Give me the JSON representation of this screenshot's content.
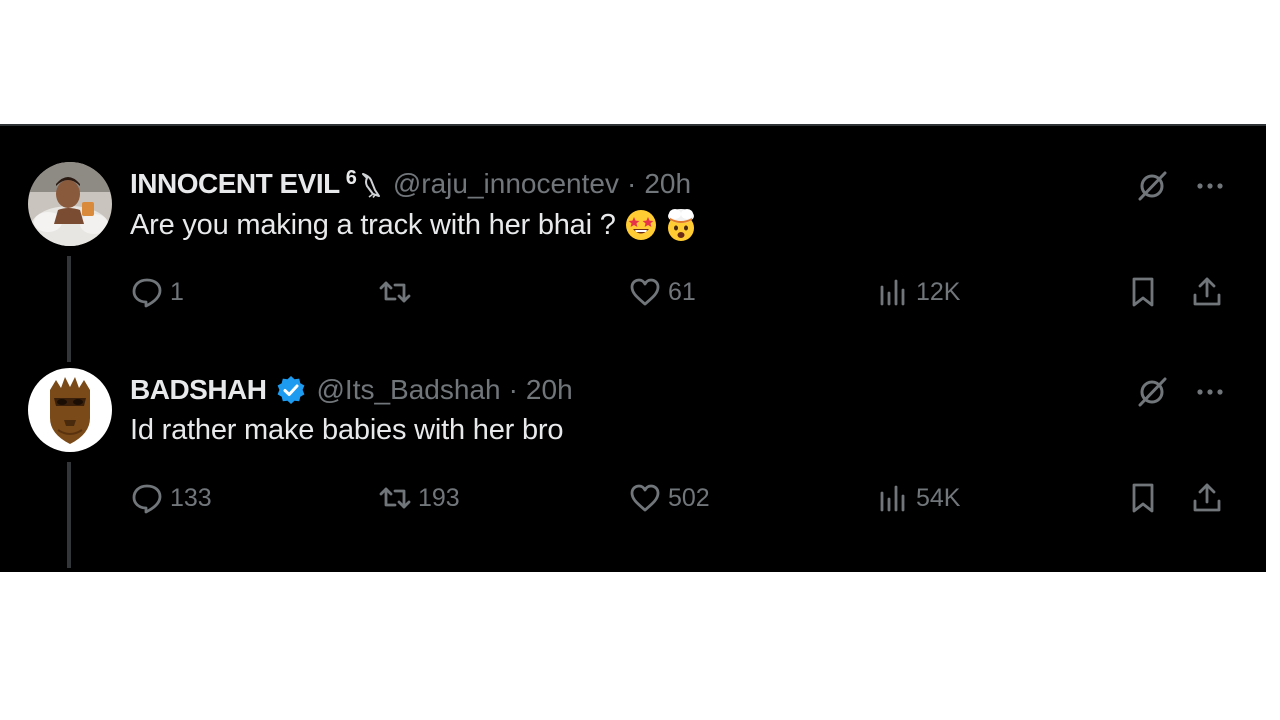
{
  "tweets": [
    {
      "name": "INNOCENT EVIL",
      "badge": "6",
      "handle": "@raju_innocentev",
      "separator": "·",
      "time": "20h",
      "text": "Are you making a track with her bhai ?",
      "emojis": [
        "star-struck-emoji",
        "exploding-head-emoji"
      ],
      "avatar": "photo-avatar",
      "replies": "1",
      "reposts": "",
      "likes": "61",
      "views": "12K"
    },
    {
      "name": "BADSHAH",
      "verified": true,
      "handle": "@Its_Badshah",
      "separator": "·",
      "time": "20h",
      "text": "Id rather make babies with her bro",
      "avatar": "mask-avatar",
      "replies": "133",
      "reposts": "193",
      "likes": "502",
      "views": "54K"
    }
  ],
  "colors": {
    "background": "#000000",
    "text": "#e7e9ea",
    "secondary": "#71767b",
    "verified": "#1d9bf0",
    "divider": "#2f3336"
  }
}
